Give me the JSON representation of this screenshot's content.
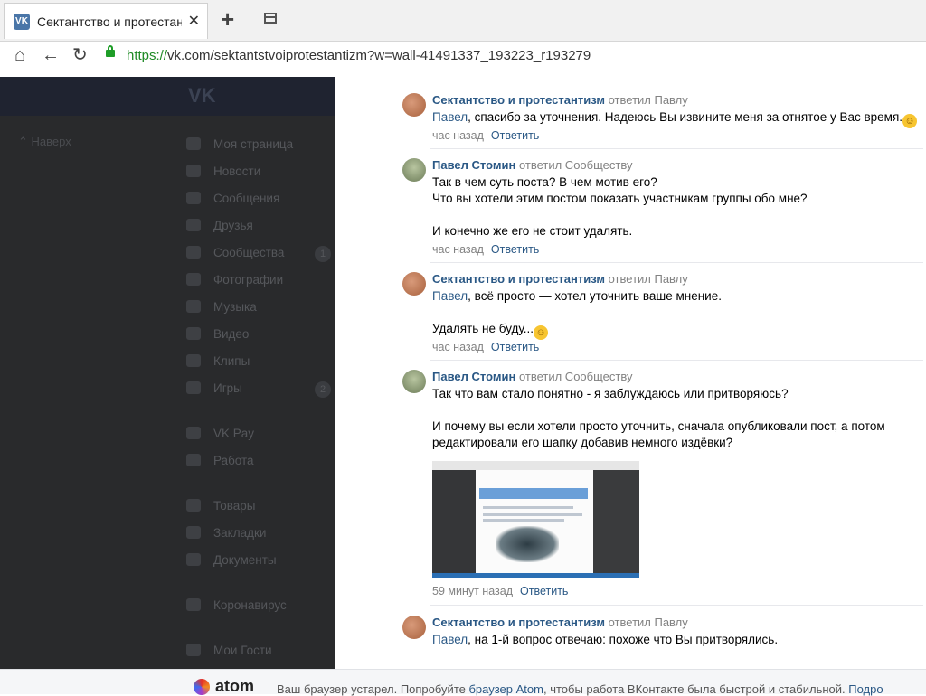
{
  "browser": {
    "tab_title": "Сектантство и протестантиз",
    "tab_close": "✕",
    "new_tab": "+",
    "url_scheme": "https://",
    "url_rest": "vk.com/sektantstvoiprotestantizm?w=wall-41491337_193223_r193279"
  },
  "sidebar": {
    "logo": "VK",
    "back": "Наверх",
    "items": [
      {
        "label": "Моя страница",
        "badge": ""
      },
      {
        "label": "Новости",
        "badge": ""
      },
      {
        "label": "Сообщения",
        "badge": ""
      },
      {
        "label": "Друзья",
        "badge": ""
      },
      {
        "label": "Сообщества",
        "badge": "1"
      },
      {
        "label": "Фотографии",
        "badge": ""
      },
      {
        "label": "Музыка",
        "badge": ""
      },
      {
        "label": "Видео",
        "badge": ""
      },
      {
        "label": "Клипы",
        "badge": ""
      },
      {
        "label": "Игры",
        "badge": "2"
      },
      {
        "label": "VK Pay",
        "badge": ""
      },
      {
        "label": "Работа",
        "badge": ""
      },
      {
        "label": "Товары",
        "badge": ""
      },
      {
        "label": "Закладки",
        "badge": ""
      },
      {
        "label": "Документы",
        "badge": ""
      },
      {
        "label": "Коронавирус",
        "badge": ""
      },
      {
        "label": "Мои Гости",
        "badge": ""
      }
    ]
  },
  "comments": [
    {
      "author": "Сектантство и протестантизм",
      "action": "ответил Павлу",
      "mention": "Павел",
      "text": ", спасибо за уточнения. Надеюсь Вы извините меня за отнятое у Вас время.",
      "time": "час назад",
      "reply": "Ответить"
    },
    {
      "author": "Павел Стомин",
      "action": "ответил Сообществу",
      "text": "Так в чем суть поста? В чем мотив его?\nЧто вы хотели этим постом показать участникам группы обо мне?\n\nИ конечно же его не стоит удалять.",
      "time": "час назад",
      "reply": "Ответить"
    },
    {
      "author": "Сектантство и протестантизм",
      "action": "ответил Павлу",
      "mention": "Павел",
      "text": ", всё просто — хотел уточнить ваше мнение.",
      "text2": "Удалять не буду...",
      "time": "час назад",
      "reply": "Ответить"
    },
    {
      "author": "Павел Стомин",
      "action": "ответил Сообществу",
      "text": "Так что вам стало понятно - я заблуждаюсь или притворяюсь?\n\nИ почему вы если хотели просто уточнить, сначала опубликовали пост, а потом\nредактировали его шапку добавив немного издёвки?",
      "time": "59 минут назад",
      "reply": "Ответить"
    },
    {
      "author": "Сектантство и протестантизм",
      "action": "ответил Павлу",
      "mention": "Павел",
      "text": ", на 1-й вопрос отвечаю: похоже что Вы притворялись."
    }
  ],
  "bottom": {
    "brand": "atom",
    "notice_a": "Ваш браузер устарел. Попробуйте ",
    "notice_link": "браузер Atom",
    "notice_b": ", чтобы работа ВКонтакте была быстрой и стабильной. ",
    "notice_link2": "Подро"
  }
}
